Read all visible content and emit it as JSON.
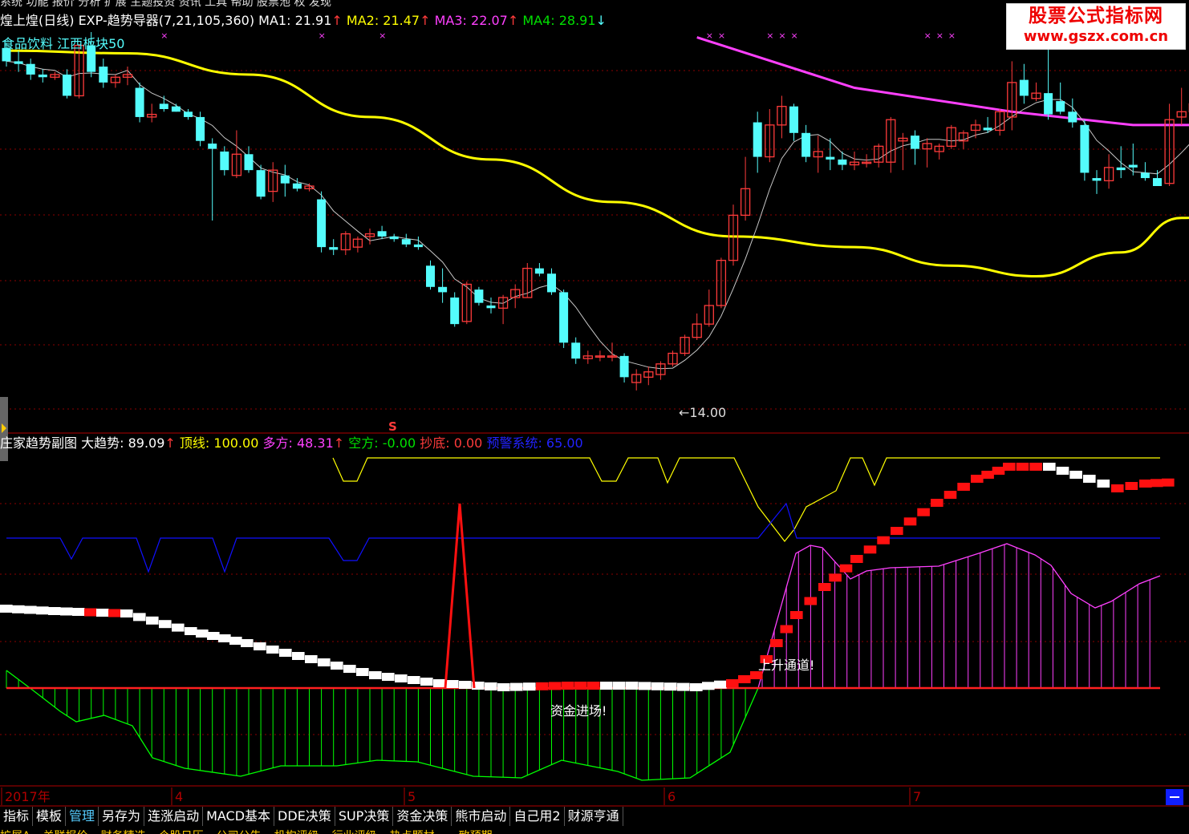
{
  "window": {
    "top_menu": [
      "系统",
      "功能",
      "报价",
      "分析",
      "扩展",
      "主题投资",
      "资讯",
      "工具",
      "帮助",
      "股票池",
      "权",
      "发现"
    ]
  },
  "watermark": {
    "line1": "股票公式指标网",
    "line2": "www.gszx.com.cn"
  },
  "main_panel": {
    "title": "煌上煌(日线) EXP-趋势导器(7,21,105,360)",
    "ma1": "MA1: 21.91",
    "ma2": "MA2: 21.47",
    "ma3": "MA3: 22.07",
    "ma4": "MA4: 28.91",
    "sector_label": "食品饮料 江西板块50",
    "low_label": "←14.00"
  },
  "sub_panel": {
    "title": "庄家趋势副图",
    "da_qushi": "大趋势: 89.09",
    "dingxian": "顶线: 100.00",
    "duofang": "多方: 48.31",
    "kongfang": "空方: -0.00",
    "chaodi": "抄底: 0.00",
    "yujing": "预警系统: 65.00",
    "s_marker": "S",
    "annotation_up": "上升通道!",
    "annotation_fund": "资金进场!"
  },
  "date_axis": [
    "2017年",
    "4",
    "5",
    "6",
    "7"
  ],
  "bottom_tabs": [
    "指标",
    "模板",
    "管理",
    "另存为",
    "连涨启动",
    "MACD基本",
    "DDE决策",
    "SUP决策",
    "资金决策",
    "熊市启动",
    "自己用2",
    "财源亨通"
  ],
  "bottom_row": [
    "扩展A",
    "关联报价",
    "财务精选",
    "个股日历",
    "公司公告",
    "机构评级",
    "行业评级",
    "热点题材",
    "一致预期"
  ],
  "colors": {
    "up": "#ff3b3b",
    "down": "#54fcfc",
    "ma1": "#c8c8c8",
    "ma2": "#ffff00",
    "ma3": "#ff40ff",
    "top_line": "#ffff00",
    "warn_line": "#1010ff",
    "green_bars": "#00ff00",
    "magenta_bars": "#ff40ff"
  },
  "chart_data": [
    {
      "type": "candlestick",
      "title": "煌上煌(日线)",
      "ylim": [
        13.0,
        27.5
      ],
      "annotation_low": 14.0,
      "candles": [
        [
          26.9,
          27.1,
          26.2,
          26.4
        ],
        [
          26.4,
          26.8,
          26.0,
          26.3
        ],
        [
          26.3,
          26.5,
          25.7,
          25.9
        ],
        [
          25.9,
          26.1,
          25.6,
          25.8
        ],
        [
          25.8,
          26.0,
          25.7,
          25.9
        ],
        [
          25.9,
          26.1,
          25.0,
          25.1
        ],
        [
          25.1,
          27.0,
          25.0,
          27.0
        ],
        [
          27.0,
          27.5,
          25.8,
          26.0
        ],
        [
          26.2,
          26.5,
          25.4,
          25.6
        ],
        [
          25.6,
          25.9,
          25.4,
          25.8
        ],
        [
          25.8,
          26.2,
          25.5,
          25.9
        ],
        [
          25.4,
          25.6,
          24.1,
          24.3
        ],
        [
          24.3,
          24.8,
          24.1,
          24.4
        ],
        [
          24.8,
          25.1,
          24.5,
          24.6
        ],
        [
          24.7,
          24.8,
          24.5,
          24.5
        ],
        [
          24.5,
          24.6,
          24.2,
          24.3
        ],
        [
          24.3,
          24.5,
          23.2,
          23.4
        ],
        [
          23.3,
          23.5,
          20.4,
          23.1
        ],
        [
          23.0,
          23.2,
          22.1,
          22.3
        ],
        [
          22.1,
          23.8,
          22.0,
          22.9
        ],
        [
          22.9,
          23.2,
          22.2,
          22.3
        ],
        [
          22.3,
          22.5,
          21.2,
          21.3
        ],
        [
          21.5,
          22.6,
          21.1,
          22.3
        ],
        [
          22.1,
          22.5,
          21.3,
          21.8
        ],
        [
          21.8,
          22.0,
          21.5,
          21.6
        ],
        [
          21.6,
          21.8,
          21.5,
          21.7
        ],
        [
          21.2,
          21.5,
          19.2,
          19.4
        ],
        [
          19.4,
          19.7,
          19.1,
          19.3
        ],
        [
          19.3,
          20.0,
          19.1,
          19.9
        ],
        [
          19.4,
          19.8,
          19.2,
          19.7
        ],
        [
          19.8,
          20.1,
          19.5,
          19.9
        ],
        [
          20.0,
          20.2,
          19.7,
          19.8
        ],
        [
          19.8,
          19.9,
          19.6,
          19.7
        ],
        [
          19.7,
          19.9,
          19.4,
          19.5
        ],
        [
          19.5,
          19.8,
          19.3,
          19.4
        ],
        [
          18.7,
          18.9,
          17.8,
          17.9
        ],
        [
          17.9,
          18.6,
          17.3,
          17.7
        ],
        [
          17.5,
          17.7,
          16.4,
          16.5
        ],
        [
          16.6,
          18.1,
          16.5,
          18.0
        ],
        [
          17.8,
          17.9,
          17.2,
          17.3
        ],
        [
          17.2,
          17.5,
          16.9,
          17.1
        ],
        [
          17.1,
          17.6,
          16.5,
          17.5
        ],
        [
          17.5,
          18.0,
          17.1,
          17.8
        ],
        [
          17.5,
          18.8,
          17.5,
          18.6
        ],
        [
          18.6,
          18.8,
          18.3,
          18.4
        ],
        [
          18.4,
          18.6,
          17.6,
          17.7
        ],
        [
          17.7,
          17.8,
          15.6,
          15.8
        ],
        [
          15.8,
          16.0,
          15.0,
          15.2
        ],
        [
          15.2,
          15.5,
          15.0,
          15.3
        ],
        [
          15.3,
          15.5,
          15.1,
          15.3
        ],
        [
          15.3,
          15.8,
          15.1,
          15.3
        ],
        [
          15.3,
          15.4,
          14.3,
          14.5
        ],
        [
          14.3,
          14.8,
          14.0,
          14.6
        ],
        [
          14.5,
          14.9,
          14.2,
          14.7
        ],
        [
          14.6,
          15.1,
          14.4,
          15.0
        ],
        [
          15.0,
          15.5,
          14.9,
          15.4
        ],
        [
          15.4,
          16.1,
          15.3,
          16.0
        ],
        [
          16.0,
          16.9,
          15.9,
          16.5
        ],
        [
          16.5,
          17.8,
          16.4,
          17.2
        ],
        [
          17.2,
          19.0,
          17.1,
          18.9
        ],
        [
          18.9,
          21.0,
          18.7,
          20.6
        ],
        [
          20.6,
          22.8,
          20.4,
          21.6
        ],
        [
          24.1,
          24.5,
          22.2,
          22.8
        ],
        [
          22.8,
          24.6,
          22.6,
          24.0
        ],
        [
          24.0,
          25.1,
          23.5,
          24.7
        ],
        [
          24.7,
          24.8,
          23.4,
          23.7
        ],
        [
          23.7,
          24.0,
          22.6,
          22.8
        ],
        [
          22.8,
          23.6,
          22.2,
          23.0
        ],
        [
          22.8,
          23.5,
          22.3,
          22.7
        ],
        [
          22.7,
          23.0,
          22.3,
          22.5
        ],
        [
          22.5,
          23.0,
          22.3,
          22.6
        ],
        [
          22.6,
          22.9,
          22.4,
          22.6
        ],
        [
          22.6,
          23.3,
          22.4,
          23.2
        ],
        [
          22.6,
          24.3,
          22.2,
          24.2
        ],
        [
          23.4,
          23.7,
          22.3,
          23.5
        ],
        [
          23.6,
          23.8,
          22.5,
          23.1
        ],
        [
          23.1,
          23.5,
          22.4,
          23.3
        ],
        [
          23.0,
          23.3,
          22.7,
          23.2
        ],
        [
          23.2,
          24.0,
          23.1,
          23.9
        ],
        [
          23.4,
          23.8,
          23.1,
          23.7
        ],
        [
          23.8,
          24.2,
          23.5,
          24.0
        ],
        [
          23.9,
          24.3,
          23.7,
          23.8
        ],
        [
          23.8,
          24.6,
          23.6,
          24.5
        ],
        [
          24.3,
          26.4,
          23.8,
          25.6
        ],
        [
          25.7,
          26.3,
          24.8,
          25.1
        ],
        [
          25.0,
          25.6,
          24.9,
          25.2
        ],
        [
          25.2,
          26.9,
          24.2,
          24.4
        ],
        [
          24.9,
          25.6,
          24.4,
          24.5
        ],
        [
          24.5,
          25.0,
          23.9,
          24.1
        ],
        [
          24.0,
          24.2,
          21.9,
          22.2
        ],
        [
          22.0,
          22.3,
          21.4,
          21.9
        ],
        [
          21.9,
          22.9,
          21.6,
          22.4
        ],
        [
          22.4,
          23.2,
          22.0,
          22.3
        ],
        [
          22.5,
          23.3,
          22.1,
          22.4
        ],
        [
          22.2,
          22.6,
          21.9,
          22.0
        ],
        [
          22.0,
          22.3,
          21.7,
          21.7
        ],
        [
          21.8,
          24.8,
          21.7,
          24.2
        ],
        [
          24.3,
          25.4,
          24.0,
          24.5
        ],
        [
          24.5,
          25.1,
          24.3,
          24.8
        ],
        [
          24.5,
          24.8,
          24.2,
          24.3
        ]
      ],
      "ma2_line": [
        [
          0,
          26.8
        ],
        [
          10,
          26.7
        ],
        [
          20,
          25.9
        ],
        [
          30,
          24.3
        ],
        [
          40,
          22.7
        ],
        [
          50,
          21.1
        ],
        [
          60,
          19.8
        ],
        [
          70,
          19.4
        ],
        [
          78,
          18.7
        ],
        [
          85,
          18.3
        ],
        [
          92,
          19.2
        ],
        [
          97,
          20.5
        ],
        [
          110,
          21.3
        ],
        [
          120,
          21.9
        ],
        [
          127,
          22.8
        ],
        [
          132,
          23.0
        ],
        [
          135,
          22.8
        ],
        [
          140,
          22.6
        ],
        [
          146,
          22.9
        ]
      ],
      "ma3_line": [
        [
          57,
          27.3
        ],
        [
          70,
          25.4
        ],
        [
          83,
          24.5
        ],
        [
          93,
          24.0
        ],
        [
          100,
          24.0
        ],
        [
          146,
          23.8
        ]
      ]
    },
    {
      "type": "indicator",
      "title": "庄家趋势副图",
      "ylim": [
        -20.0,
        100.0
      ],
      "top_line_value": 100.0,
      "warn_line_value": 65.0,
      "series": [
        {
          "name": "大趋势",
          "value": 89.09
        },
        {
          "name": "顶线",
          "value": 100.0
        },
        {
          "name": "多方",
          "value": 48.31
        },
        {
          "name": "空方",
          "value": -0.0
        },
        {
          "name": "抄底",
          "value": 0.0
        },
        {
          "name": "预警系统",
          "value": 65.0
        }
      ]
    }
  ]
}
